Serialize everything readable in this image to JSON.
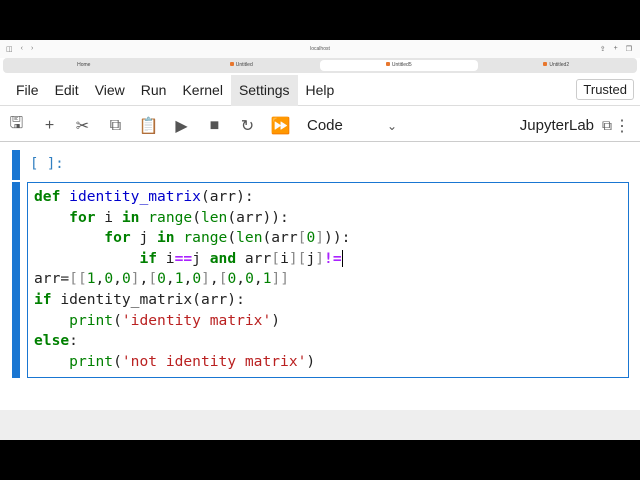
{
  "browser": {
    "url": "localhost",
    "tabs": [
      {
        "label": "Home",
        "active": false
      },
      {
        "label": "Untitled",
        "active": false
      },
      {
        "label": "Untitled5",
        "active": true
      },
      {
        "label": "Untitled2",
        "active": false
      }
    ]
  },
  "menu": [
    "File",
    "Edit",
    "View",
    "Run",
    "Kernel",
    "Settings",
    "Help"
  ],
  "trusted": "Trusted",
  "toolbar": {
    "cell_type": "Code",
    "kernel": "JupyterLab"
  },
  "cell1": {
    "prompt": "[ ]:"
  },
  "code_lines": [
    "def identity_matrix(arr):",
    "    for i in range(len(arr)):",
    "        for j in range(len(arr[0])):",
    "            if i==j and arr[i][j]!=",
    "arr=[[1,0,0],[0,1,0],[0,0,1]]",
    "if identity_matrix(arr):",
    "    print('identity matrix')",
    "else:",
    "    print('not identity matrix')"
  ],
  "colors": {
    "accent": "#1976d2"
  }
}
